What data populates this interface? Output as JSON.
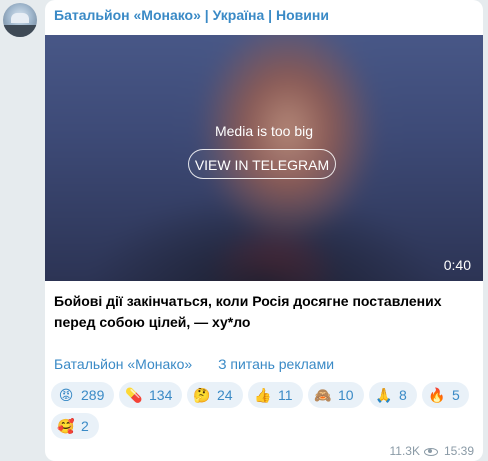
{
  "channel": {
    "name": "Батальйон «Монако» | Україна | Новини"
  },
  "media": {
    "notice": "Media is too big",
    "button_label": "VIEW IN TELEGRAM",
    "duration": "0:40"
  },
  "post": {
    "text": "Бойові дії закінчаться, коли Росія досягне поставлених перед собою цілей, — ху*ло"
  },
  "links": {
    "first": "Батальйон «Монако»",
    "second": "З питань реклами"
  },
  "reactions": [
    {
      "emoji": "😡",
      "icon": "pouting-face-icon",
      "count": "289"
    },
    {
      "emoji": "💊",
      "icon": "pill-icon",
      "count": "134"
    },
    {
      "emoji": "🤔",
      "icon": "thinking-face-icon",
      "count": "24"
    },
    {
      "emoji": "👍",
      "icon": "thumbs-up-icon",
      "count": "11"
    },
    {
      "emoji": "🙈",
      "icon": "see-no-evil-monkey-icon",
      "count": "10"
    },
    {
      "emoji": "🙏",
      "icon": "folded-hands-icon",
      "count": "8"
    },
    {
      "emoji": "🔥",
      "icon": "fire-icon",
      "count": "5"
    },
    {
      "emoji": "🥰",
      "icon": "smiling-face-with-hearts-icon",
      "count": "2"
    }
  ],
  "meta": {
    "views": "11.3K",
    "time": "15:39"
  },
  "colors": {
    "accent": "#3a8ac6",
    "reaction_bg": "#e9f1f8",
    "page_bg": "#e6ebee"
  }
}
